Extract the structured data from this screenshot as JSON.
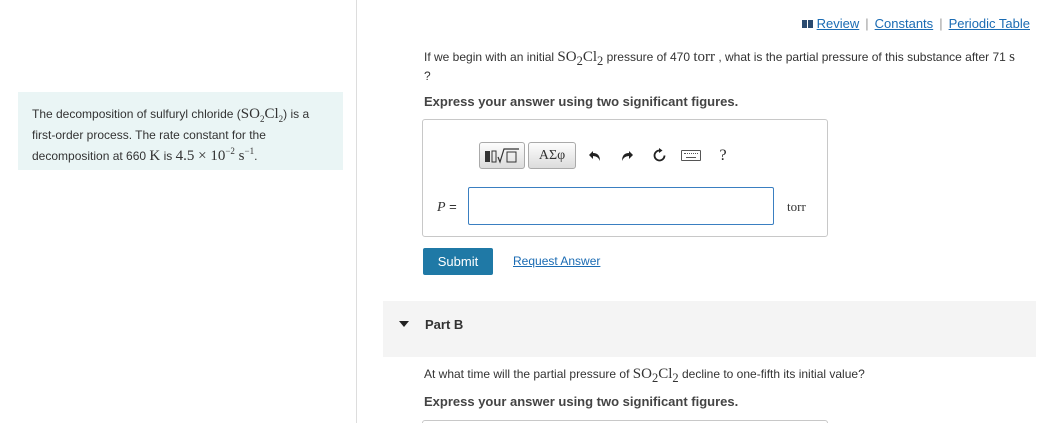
{
  "header": {
    "links": [
      "Review",
      "Constants",
      "Periodic Table"
    ],
    "separator": "|"
  },
  "info": {
    "text1": "The decomposition of sulfuryl chloride (",
    "formula": "SO",
    "formula_sub1": "2",
    "formula_mid": "Cl",
    "formula_sub2": "2",
    "text2": ") is a first-order process. The rate constant for the decomposition at 660 ",
    "kelvin": "K",
    "text3": " is ",
    "rate": "4.5 × 10",
    "rate_exp": "−2",
    "unit": "s",
    "unit_exp": "−1",
    "end": "."
  },
  "partA": {
    "q1": "If we begin with an initial ",
    "species": "SO",
    "species_sub1": "2",
    "species_mid": "Cl",
    "species_sub2": "2",
    "q2": " pressure of 470 ",
    "torr_inline": "torr",
    "q3": " , what is the partial pressure of this substance after 71 ",
    "s_inline": "s",
    "q4": " ?",
    "instruction": "Express your answer using two significant figures.",
    "toolbar": {
      "greek_label": "ΑΣφ",
      "help_label": "?"
    },
    "var_label": "P",
    "equals": " =",
    "input_value": "",
    "unit": "torr",
    "submit_label": "Submit",
    "request_label": "Request Answer"
  },
  "partB": {
    "title": "Part B",
    "q1": "At what time will the partial pressure of ",
    "species": "SO",
    "species_sub1": "2",
    "species_mid": "Cl",
    "species_sub2": "2",
    "q2": " decline to one-fifth its initial value?",
    "instruction": "Express your answer using two significant figures."
  },
  "colors": {
    "accent": "#1f79a6",
    "link": "#1a6bb3",
    "info_bg": "#eaf5f5"
  }
}
